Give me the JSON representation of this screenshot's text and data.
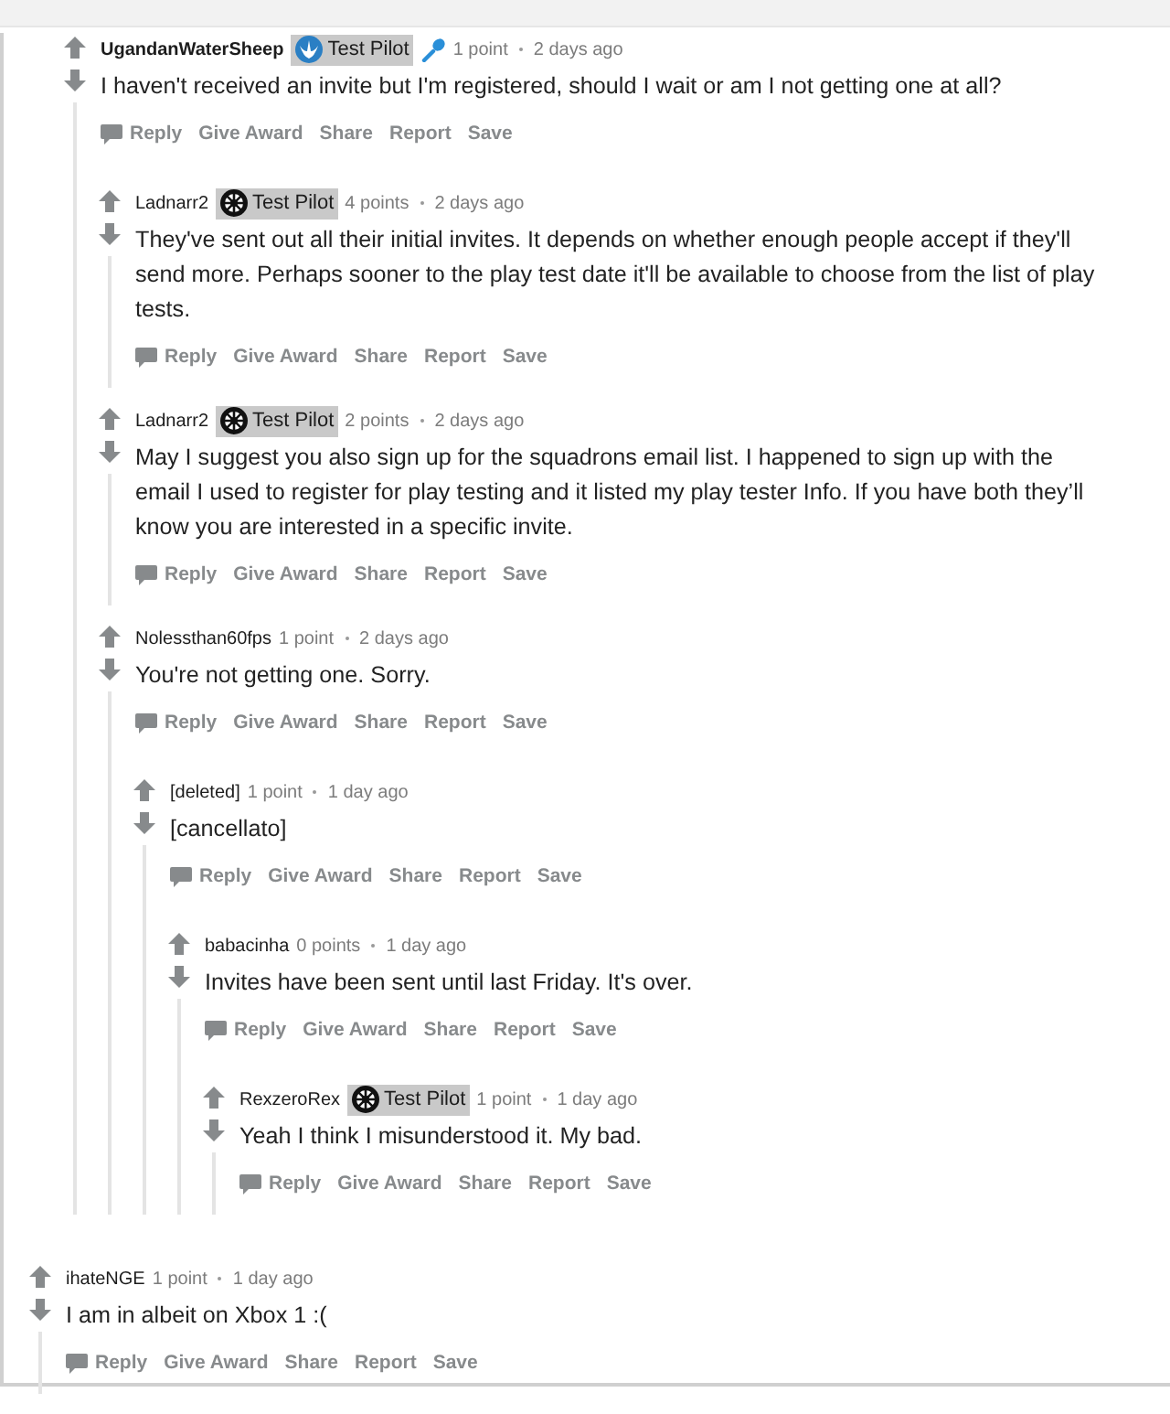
{
  "partial_thread": [
    {
      "author": "UgandanWaterSheep",
      "author_bold": true,
      "flair": {
        "kind": "rebel",
        "text": "Test Pilot"
      },
      "pen_icon": true,
      "score": "1 point",
      "age": "2 days ago",
      "body": "I haven't received an invite but I'm registered, should I wait or am I not getting one at all?",
      "actions": [
        "Reply",
        "Give Award",
        "Share",
        "Report",
        "Save"
      ],
      "children": [
        {
          "author": "Ladnarr2",
          "author_bold": false,
          "flair": {
            "kind": "empire",
            "text": "Test Pilot"
          },
          "pen_icon": false,
          "score": "4 points",
          "age": "2 days ago",
          "body": "They've sent out all their initial invites. It depends on whether enough people accept if they'll send more. Perhaps sooner to the play test date it'll be available to choose from the list of play tests.",
          "actions": [
            "Reply",
            "Give Award",
            "Share",
            "Report",
            "Save"
          ]
        },
        {
          "author": "Ladnarr2",
          "author_bold": false,
          "flair": {
            "kind": "empire",
            "text": "Test Pilot"
          },
          "pen_icon": false,
          "score": "2 points",
          "age": "2 days ago",
          "body": "May I suggest you also sign up for the squadrons email list. I happened to sign up with the email I used to register for play testing and it listed my play tester Info. If you have both they’ll know you are interested in a specific invite.",
          "actions": [
            "Reply",
            "Give Award",
            "Share",
            "Report",
            "Save"
          ]
        },
        {
          "author": "Nolessthan60fps",
          "author_bold": false,
          "pen_icon": false,
          "score": "1 point",
          "age": "2 days ago",
          "body": "You're not getting one. Sorry.",
          "actions": [
            "Reply",
            "Give Award",
            "Share",
            "Report",
            "Save"
          ],
          "children": [
            {
              "author": "[deleted]",
              "author_bold": false,
              "pen_icon": false,
              "score": "1 point",
              "age": "1 day ago",
              "body": "[cancellato]",
              "actions": [
                "Reply",
                "Give Award",
                "Share",
                "Report",
                "Save"
              ],
              "children": [
                {
                  "author": "babacinha",
                  "author_bold": false,
                  "pen_icon": false,
                  "score": "0 points",
                  "age": "1 day ago",
                  "body": "Invites have been sent until last Friday. It's over.",
                  "actions": [
                    "Reply",
                    "Give Award",
                    "Share",
                    "Report",
                    "Save"
                  ],
                  "children": [
                    {
                      "author": "RexzeroRex",
                      "author_bold": false,
                      "flair": {
                        "kind": "empire",
                        "text": "Test Pilot"
                      },
                      "pen_icon": false,
                      "score": "1 point",
                      "age": "1 day ago",
                      "body": "Yeah I think I misunderstood it. My bad.",
                      "actions": [
                        "Reply",
                        "Give Award",
                        "Share",
                        "Report",
                        "Save"
                      ]
                    }
                  ]
                }
              ]
            }
          ]
        }
      ]
    }
  ],
  "comments": [
    {
      "author": "ihateNGE",
      "author_bold": false,
      "pen_icon": false,
      "score": "1 point",
      "age": "1 day ago",
      "body": "I am in albeit on Xbox 1 :(",
      "actions": [
        "Reply",
        "Give Award",
        "Share",
        "Report",
        "Save"
      ]
    }
  ]
}
